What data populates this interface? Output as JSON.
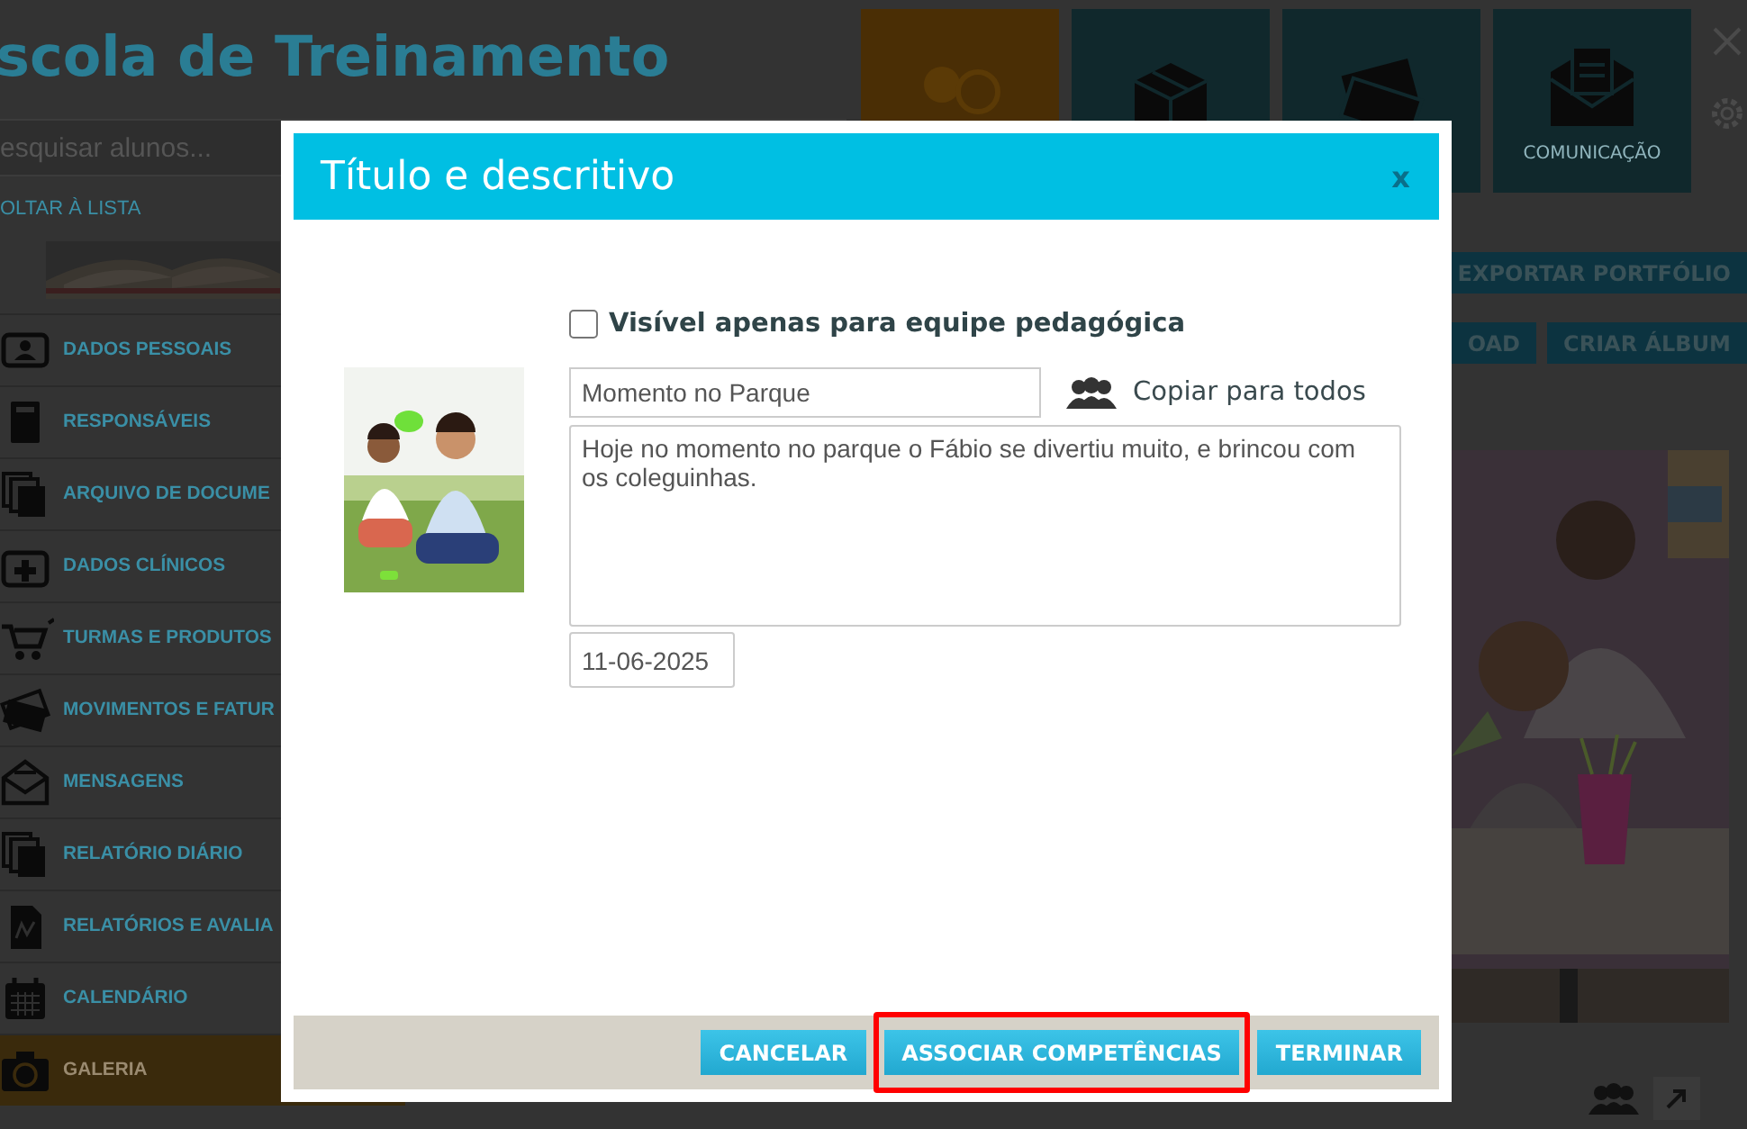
{
  "app": {
    "title": "scola de Treinamento",
    "search": {
      "placeholder": "esquisar alunos..."
    },
    "back_link": "OLTAR À LISTA",
    "tiles": [
      {
        "kind": "people",
        "selected": true
      },
      {
        "kind": "box",
        "selected": false
      },
      {
        "kind": "money",
        "selected": false
      },
      {
        "kind": "mail",
        "label": "COMUNICAÇÃO",
        "selected": false
      }
    ],
    "sidebar": {
      "items": [
        {
          "kind": "id-card",
          "label": "DADOS PESSOAIS",
          "selected": false
        },
        {
          "kind": "notebook",
          "label": "RESPONSÁVEIS",
          "selected": false
        },
        {
          "kind": "documents",
          "label": "ARQUIVO DE DOCUME",
          "selected": false
        },
        {
          "kind": "medical",
          "label": "DADOS CLÍNICOS",
          "selected": false
        },
        {
          "kind": "cart",
          "label": "TURMAS E PRODUTOS",
          "selected": false
        },
        {
          "kind": "money",
          "label": "MOVIMENTOS E FATUR",
          "selected": false
        },
        {
          "kind": "envelope",
          "label": "MENSAGENS",
          "selected": false
        },
        {
          "kind": "documents",
          "label": "RELATÓRIO DIÁRIO",
          "selected": false
        },
        {
          "kind": "chart",
          "label": "RELATÓRIOS E AVALIA",
          "selected": false
        },
        {
          "kind": "calendar",
          "label": "CALENDÁRIO",
          "selected": false
        },
        {
          "kind": "camera",
          "label": "GALERIA",
          "selected": true
        }
      ]
    },
    "actions": [
      [
        "EXPORTAR PORTFÓLIO"
      ],
      [
        "OAD",
        "CRIAR ÁLBUM"
      ]
    ]
  },
  "dialog": {
    "title": "Título e descritivo",
    "close": "x",
    "team_only": {
      "label": "Visível apenas para equipe pedagógica",
      "checked": false
    },
    "title_field": {
      "value": "Momento no Parque"
    },
    "copy_all": "Copiar para todos",
    "description": {
      "value": "Hoje no momento no parque o Fábio se divertiu muito, e brincou com os coleguinhas."
    },
    "date": {
      "value": "11-06-2025"
    },
    "buttons": [
      {
        "label": "CANCELAR",
        "highlighted": false
      },
      {
        "label": "ASSOCIAR COMPETÊNCIAS",
        "highlighted": true
      },
      {
        "label": "TERMINAR",
        "highlighted": false
      }
    ]
  }
}
